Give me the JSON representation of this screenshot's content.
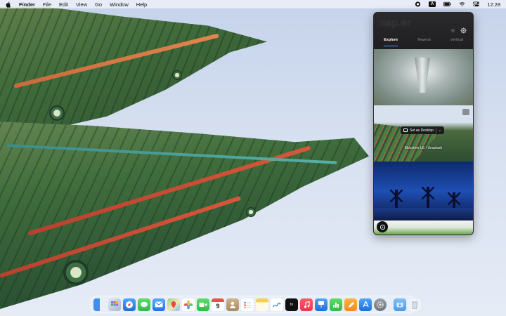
{
  "menubar": {
    "app_name": "Finder",
    "menus": [
      "File",
      "Edit",
      "View",
      "Go",
      "Window",
      "Help"
    ],
    "status_icons": [
      "napper-status-icon",
      "input-source-icon",
      "battery-icon",
      "wifi-icon",
      "control-center-icon"
    ],
    "input_source": "A",
    "clock": "12:28"
  },
  "napper": {
    "logo": "nap.er",
    "tabs": [
      "Explore",
      "Newest",
      "Vertical"
    ],
    "active_tab": "Explore",
    "set_button": "Set as Desktop",
    "photo_caption": "Bloesther LE / Unsplash",
    "accent": "#4a90ff"
  },
  "dock": {
    "apps": [
      "finder",
      "launchpad",
      "safari",
      "messages",
      "mail",
      "maps",
      "photos",
      "facetime",
      "calendar",
      "contacts",
      "reminders",
      "notes",
      "freeform",
      "tv",
      "music",
      "keynote",
      "numbers",
      "pages",
      "app-store",
      "system-settings"
    ],
    "calendar_day": "9",
    "tv_label": "tv",
    "trailing": [
      "downloads",
      "trash"
    ]
  }
}
